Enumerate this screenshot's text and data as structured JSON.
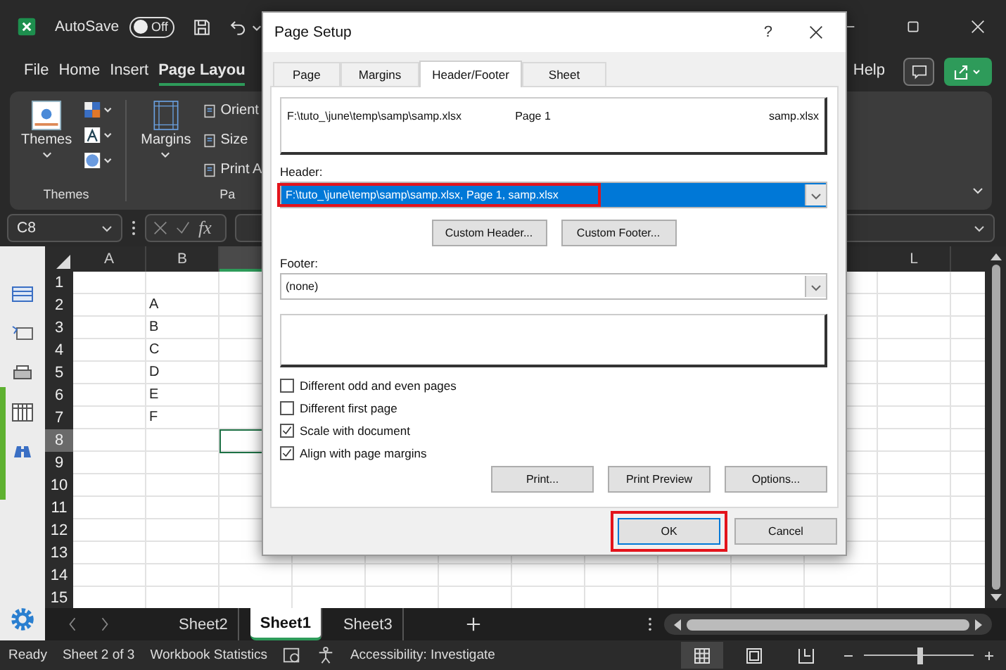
{
  "title_bar": {
    "autosave_label": "AutoSave",
    "autosave_toggle": {
      "label": "Off",
      "on": false
    }
  },
  "menu_tabs": [
    {
      "label": "File",
      "selected": false
    },
    {
      "label": "Home",
      "selected": false
    },
    {
      "label": "Insert",
      "selected": false
    },
    {
      "label": "Page Layou",
      "selected": true
    }
  ],
  "help_tab": {
    "label": "Help",
    "selected": false
  },
  "ribbon": {
    "themes_button": "Themes",
    "themes_group_label": "Themes",
    "margins_button": "Margins",
    "page_setup_items": [
      "Orient",
      "Size",
      "Print A"
    ],
    "page_setup_group_label": "Pa"
  },
  "formula_bar": {
    "name_box": "C8",
    "function_label": "fx"
  },
  "sheet": {
    "columns": [
      {
        "label": "A"
      },
      {
        "label": "B"
      },
      {
        "label": "L"
      }
    ],
    "rows": [
      {
        "number": "1",
        "selected": false
      },
      {
        "number": "2",
        "column_b": "A",
        "selected": false
      },
      {
        "number": "3",
        "column_b": "B",
        "selected": false
      },
      {
        "number": "4",
        "column_b": "C",
        "selected": false
      },
      {
        "number": "5",
        "column_b": "D",
        "selected": false
      },
      {
        "number": "6",
        "column_b": "E",
        "selected": false
      },
      {
        "number": "7",
        "column_b": "F",
        "selected": false
      },
      {
        "number": "8",
        "selected": true
      },
      {
        "number": "9",
        "selected": false
      },
      {
        "number": "10",
        "selected": false
      },
      {
        "number": "11",
        "selected": false
      },
      {
        "number": "12",
        "selected": false
      },
      {
        "number": "13",
        "selected": false
      },
      {
        "number": "14",
        "selected": false
      },
      {
        "number": "15",
        "selected": false
      }
    ]
  },
  "sheet_tabs": [
    {
      "label": "Sheet2",
      "selected": false
    },
    {
      "label": "Sheet1",
      "selected": true
    },
    {
      "label": "Sheet3",
      "selected": false
    }
  ],
  "status_bar": {
    "ready": "Ready",
    "sheet_position": "Sheet 2 of 3",
    "workbook_statistics": "Workbook Statistics",
    "accessibility": "Accessibility: Investigate",
    "views": [
      {
        "kind": "normal",
        "selected": true
      },
      {
        "kind": "page_layout",
        "selected": false
      },
      {
        "kind": "page_break",
        "selected": false
      }
    ],
    "zoom": {
      "level": 0.51
    }
  },
  "dialog": {
    "title": "Page Setup",
    "help": "?",
    "tabs": [
      {
        "label": "Page",
        "selected": false
      },
      {
        "label": "Margins",
        "selected": false
      },
      {
        "label": "Header/Footer",
        "selected": true
      },
      {
        "label": "Sheet",
        "selected": false
      }
    ],
    "header_preview": {
      "left": "F:\\tuto_\\june\\temp\\samp\\samp.xlsx",
      "center": "Page 1",
      "right": "samp.xlsx"
    },
    "header_label": "Header:",
    "header_select": {
      "value": "F:\\tuto_\\june\\temp\\samp\\samp.xlsx, Page 1, samp.xlsx",
      "focused": true,
      "highlighted": true
    },
    "custom_buttons": [
      "Custom Header...",
      "Custom Footer..."
    ],
    "footer_label": "Footer:",
    "footer_select": {
      "value": "(none)",
      "focused": false,
      "highlighted": false
    },
    "options": [
      {
        "label": "Different odd and even pages",
        "checked": false
      },
      {
        "label": "Different first page",
        "checked": false
      },
      {
        "label": "Scale with document",
        "checked": true
      },
      {
        "label": "Align with page margins",
        "checked": true
      }
    ],
    "action_buttons": [
      "Print...",
      "Print Preview",
      "Options..."
    ],
    "footer_buttons": [
      {
        "label": "OK",
        "default": true,
        "highlighted": true
      },
      {
        "label": "Cancel",
        "default": false,
        "highlighted": false
      }
    ]
  }
}
